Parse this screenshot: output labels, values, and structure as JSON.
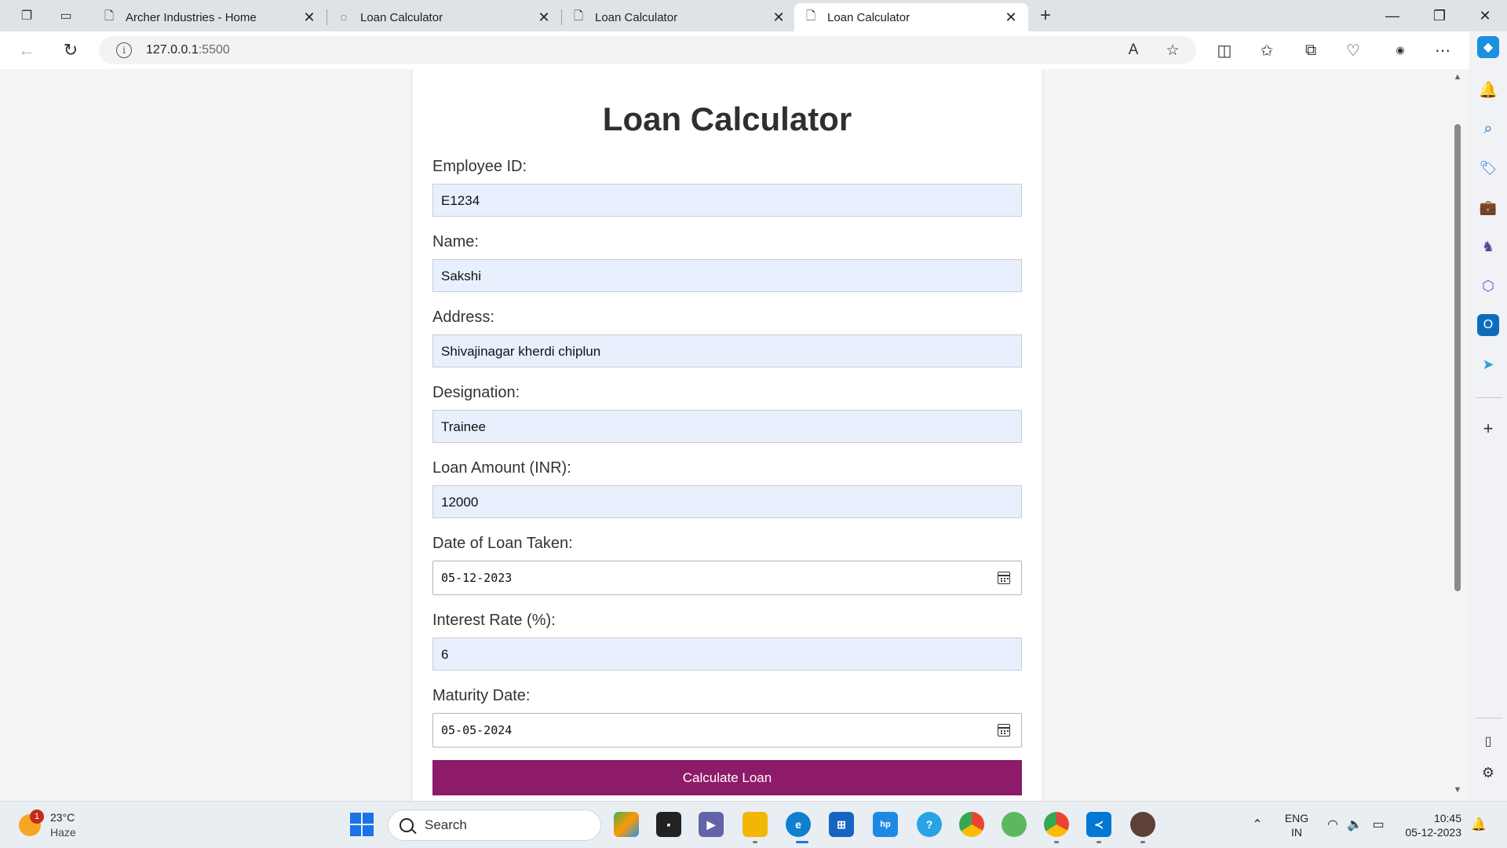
{
  "tabs": [
    {
      "label": "Archer Industries - Home",
      "active": false
    },
    {
      "label": "Loan Calculator",
      "active": false
    },
    {
      "label": "Loan Calculator",
      "active": false
    },
    {
      "label": "Loan Calculator",
      "active": true
    }
  ],
  "address_bar": {
    "host": "127.0.0.1",
    "port": ":5500"
  },
  "page": {
    "title": "Loan Calculator",
    "fields": [
      {
        "label": "Employee ID:",
        "value": "E1234"
      },
      {
        "label": "Name:",
        "value": "Sakshi"
      },
      {
        "label": "Address:",
        "value": "Shivajinagar kherdi chiplun"
      },
      {
        "label": "Designation:",
        "value": "Trainee"
      },
      {
        "label": "Loan Amount (INR):",
        "value": "12000"
      },
      {
        "label": "Date of Loan Taken:",
        "value": "05-12-2023"
      },
      {
        "label": "Interest Rate (%):",
        "value": "6"
      },
      {
        "label": "Maturity Date:",
        "value": "05-05-2024"
      }
    ],
    "submit_label": "Calculate Loan"
  },
  "taskbar": {
    "weather": {
      "temp": "23°C",
      "condition": "Haze",
      "badge": "1"
    },
    "search_placeholder": "Search",
    "lang_line1": "ENG",
    "lang_line2": "IN",
    "time": "10:45",
    "date": "05-12-2023"
  },
  "colors": {
    "accent_button": "#8e1a6a",
    "autofill_bg": "#e8f0fe"
  }
}
